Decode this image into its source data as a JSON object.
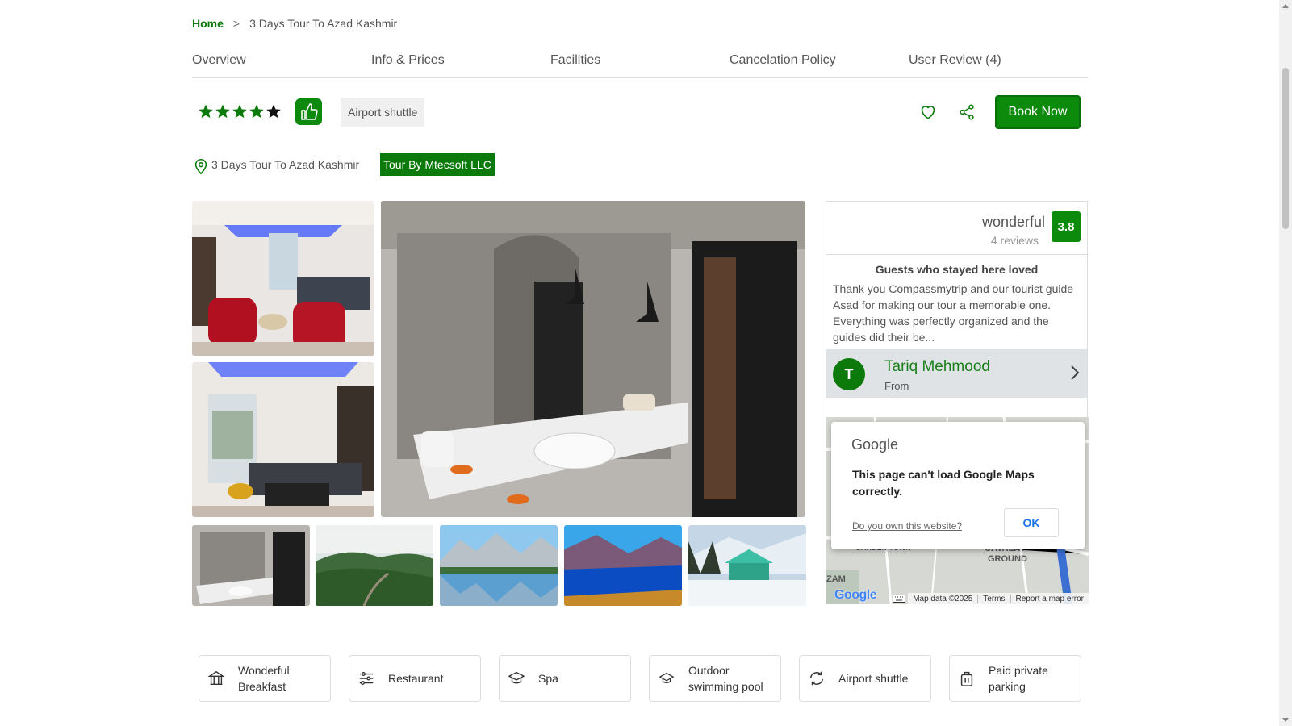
{
  "breadcrumb": {
    "home": "Home",
    "separator": ">",
    "current": "3 Days Tour To Azad Kashmir"
  },
  "tabs": [
    "Overview",
    "Info & Prices",
    "Facilities",
    "Cancelation Policy",
    "User Review (4)"
  ],
  "rating": {
    "stars_filled": 4,
    "stars_total": 5,
    "tag": "Airport shuttle"
  },
  "actions": {
    "book_now": "Book Now"
  },
  "location": {
    "text": "3 Days Tour To Azad Kashmir",
    "operator_badge": "Tour By Mtecsoft LLC"
  },
  "gallery": {
    "main": [
      "living-room-photo",
      "living-room-photo-2",
      "bathroom-photo"
    ],
    "thumbnails": [
      "bathroom-thumbnail",
      "green-valley-thumbnail",
      "mountain-lake-thumbnail",
      "blue-lake-thumbnail",
      "snowy-cabin-thumbnail"
    ]
  },
  "review_card": {
    "label": "wonderful",
    "reviews_count": "4 reviews",
    "score": "3.8",
    "loved_title": "Guests who stayed here loved",
    "loved_text": "Thank you Compassmytrip and our tourist guide Asad for making our tour a memorable one. Everything was perfectly organized and the guides did their be...",
    "reviewer": {
      "initial": "T",
      "name": "Tariq Mehmood",
      "from": "From"
    }
  },
  "map": {
    "dialog_brand": "Google",
    "dialog_message": "This page can't load Google Maps correctly.",
    "dialog_link": "Do you own this website?",
    "dialog_ok": "OK",
    "labels": [
      "GARDEN TOWN",
      "CAVALRY",
      "GROUND",
      "ZAM"
    ],
    "attribution": [
      "Map data ©2025",
      "Terms",
      "Report a map error"
    ],
    "logo": "Google"
  },
  "facilities": [
    {
      "icon": "bank-icon",
      "label": "Wonderful Breakfast"
    },
    {
      "icon": "sliders-icon",
      "label": "Restaurant"
    },
    {
      "icon": "spa-icon",
      "label": "Spa"
    },
    {
      "icon": "pool-icon",
      "label": "Outdoor swimming pool"
    },
    {
      "icon": "refresh-icon",
      "label": "Airport shuttle"
    },
    {
      "icon": "parking-bag-icon",
      "label": "Paid private parking"
    }
  ],
  "colors": {
    "brand_green": "#0b8a0b",
    "text": "#333333"
  }
}
